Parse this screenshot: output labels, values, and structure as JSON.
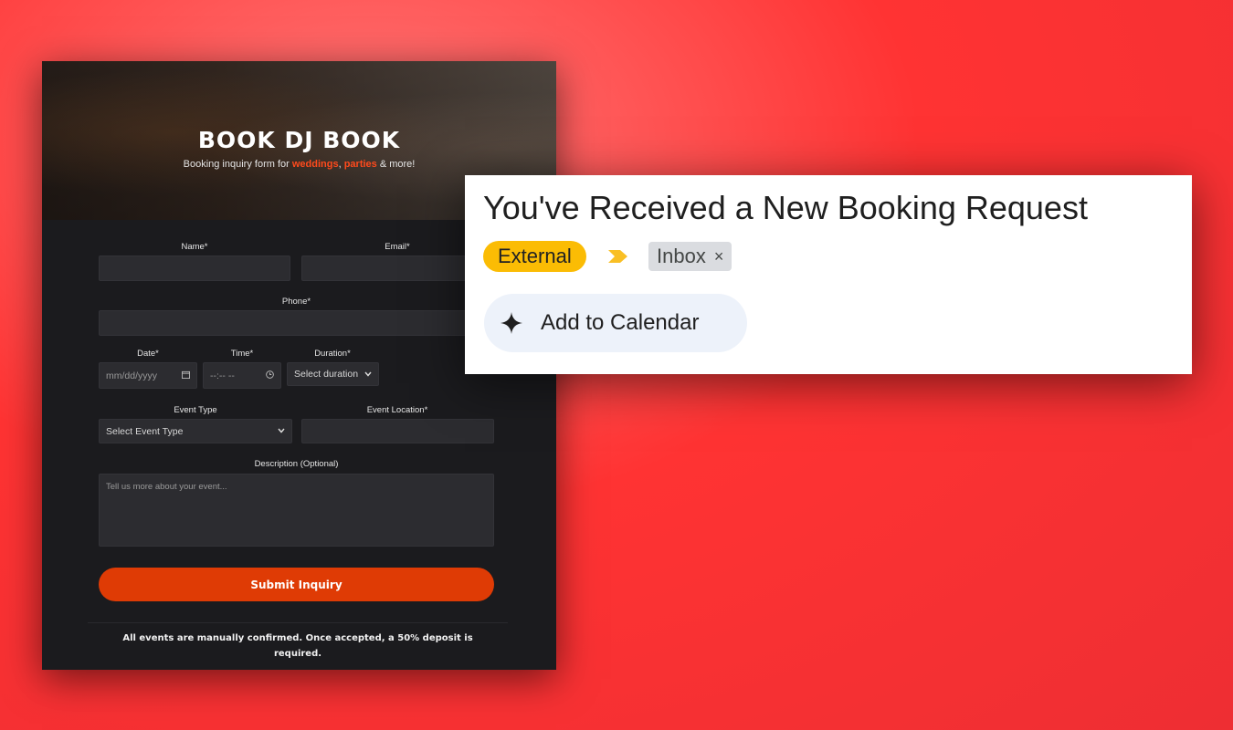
{
  "form": {
    "title": "BOOK DJ BOOK",
    "subtitle_pre": "Booking inquiry form for ",
    "subtitle_hl1": "weddings",
    "subtitle_mid": ", ",
    "subtitle_hl2": "parties",
    "subtitle_post": " & more!",
    "name_label": "Name*",
    "email_label": "Email*",
    "phone_label": "Phone*",
    "date_label": "Date*",
    "date_placeholder": "mm/dd/yyyy",
    "time_label": "Time*",
    "time_placeholder": "--:-- --",
    "duration_label": "Duration*",
    "duration_value": "Select duration",
    "event_type_label": "Event Type",
    "event_type_value": "Select Event Type",
    "event_location_label": "Event Location*",
    "description_label": "Description (Optional)",
    "description_placeholder": "Tell us more about your event...",
    "submit_label": "Submit Inquiry",
    "footer_note": "All events are manually confirmed. Once accepted, a 50% deposit is required."
  },
  "email": {
    "subject": "You've Received a New Booking Request",
    "label_external": "External",
    "label_inbox": "Inbox",
    "remove_symbol": "×",
    "add_calendar_label": "Add to Calendar"
  },
  "colors": {
    "accent": "#df3b05",
    "external_tag": "#fbbc04",
    "background": "#f33b3b"
  }
}
